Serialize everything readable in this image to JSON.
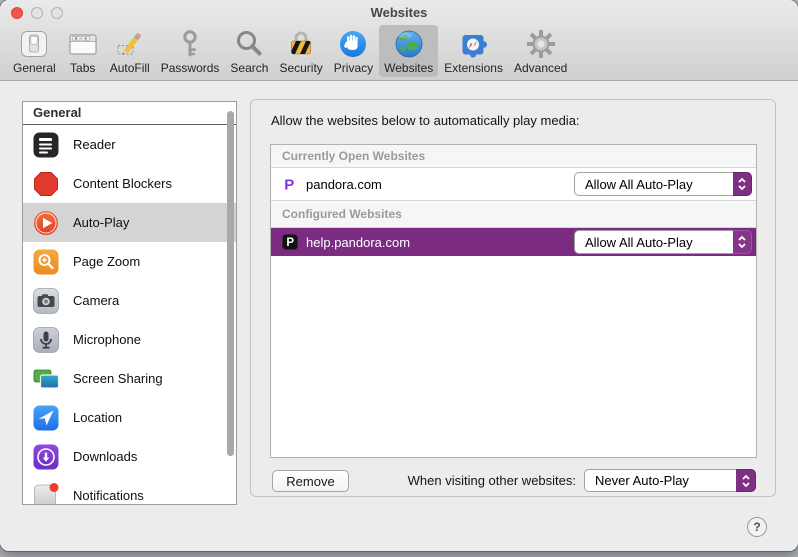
{
  "window": {
    "title": "Websites"
  },
  "toolbar": {
    "items": [
      {
        "label": "General",
        "icon": "switch-icon",
        "selected": false
      },
      {
        "label": "Tabs",
        "icon": "tabs-icon",
        "selected": false
      },
      {
        "label": "AutoFill",
        "icon": "pencil-icon",
        "selected": false
      },
      {
        "label": "Passwords",
        "icon": "key-icon",
        "selected": false
      },
      {
        "label": "Search",
        "icon": "magnifier-icon",
        "selected": false
      },
      {
        "label": "Security",
        "icon": "lock-icon",
        "selected": false
      },
      {
        "label": "Privacy",
        "icon": "hand-icon",
        "selected": false
      },
      {
        "label": "Websites",
        "icon": "globe-icon",
        "selected": true
      },
      {
        "label": "Extensions",
        "icon": "puzzle-icon",
        "selected": false
      },
      {
        "label": "Advanced",
        "icon": "gear-icon",
        "selected": false
      }
    ]
  },
  "sidebar": {
    "header": "General",
    "items": [
      {
        "label": "Reader",
        "icon": "reader-icon",
        "selected": false
      },
      {
        "label": "Content Blockers",
        "icon": "content-blocker-icon",
        "selected": false
      },
      {
        "label": "Auto-Play",
        "icon": "auto-play-icon",
        "selected": true
      },
      {
        "label": "Page Zoom",
        "icon": "page-zoom-icon",
        "selected": false
      },
      {
        "label": "Camera",
        "icon": "camera-icon",
        "selected": false
      },
      {
        "label": "Microphone",
        "icon": "microphone-icon",
        "selected": false
      },
      {
        "label": "Screen Sharing",
        "icon": "screen-sharing-icon",
        "selected": false
      },
      {
        "label": "Location",
        "icon": "location-icon",
        "selected": false
      },
      {
        "label": "Downloads",
        "icon": "downloads-icon",
        "selected": false
      },
      {
        "label": "Notifications",
        "icon": "notifications-icon",
        "selected": false
      }
    ]
  },
  "panel": {
    "heading": "Allow the websites below to automatically play media:",
    "sections": [
      {
        "header": "Currently Open Websites",
        "rows": [
          {
            "site": "pandora.com",
            "favicon": "pandora-gradient-p-icon",
            "value": "Allow All Auto-Play",
            "selected": false
          }
        ]
      },
      {
        "header": "Configured Websites",
        "rows": [
          {
            "site": "help.pandora.com",
            "favicon": "pandora-black-p-icon",
            "value": "Allow All Auto-Play",
            "selected": true
          }
        ]
      }
    ],
    "remove_label": "Remove",
    "other_label": "When visiting other websites:",
    "other_value": "Never Auto-Play",
    "help_label": "?"
  },
  "colors": {
    "accent_purple": "#7b2c80",
    "stepper_purple": "#7d3084",
    "selected_sidebar_row": "#d4d4d4",
    "toolbar_selected": "#bdbdbd",
    "window_background": "#ececec"
  }
}
